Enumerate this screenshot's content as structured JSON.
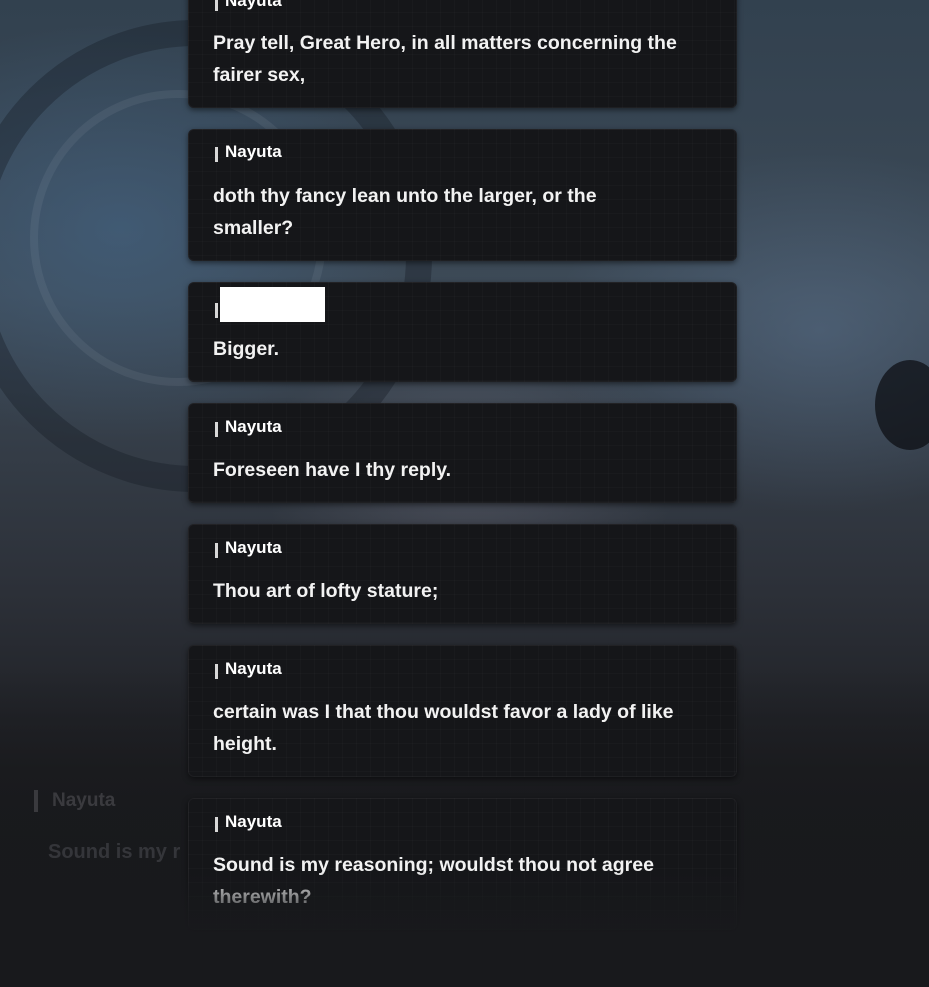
{
  "background": {
    "ghost_speaker": "Nayuta",
    "ghost_text": "Sound is my r"
  },
  "log": [
    {
      "speaker": "Nayuta",
      "text": "Pray tell, Great Hero, in all matters concerning the fairer sex,"
    },
    {
      "speaker": "Nayuta",
      "text": "doth thy fancy lean unto the larger, or the smaller?"
    },
    {
      "speaker": "",
      "text": "Bigger."
    },
    {
      "speaker": "Nayuta",
      "text": "Foreseen have I thy reply."
    },
    {
      "speaker": "Nayuta",
      "text": "Thou art of lofty stature;"
    },
    {
      "speaker": "Nayuta",
      "text": "certain was I that thou wouldst favor a lady of like height."
    },
    {
      "speaker": "Nayuta",
      "text": "Sound is my reasoning; wouldst thou not agree therewith?"
    }
  ]
}
